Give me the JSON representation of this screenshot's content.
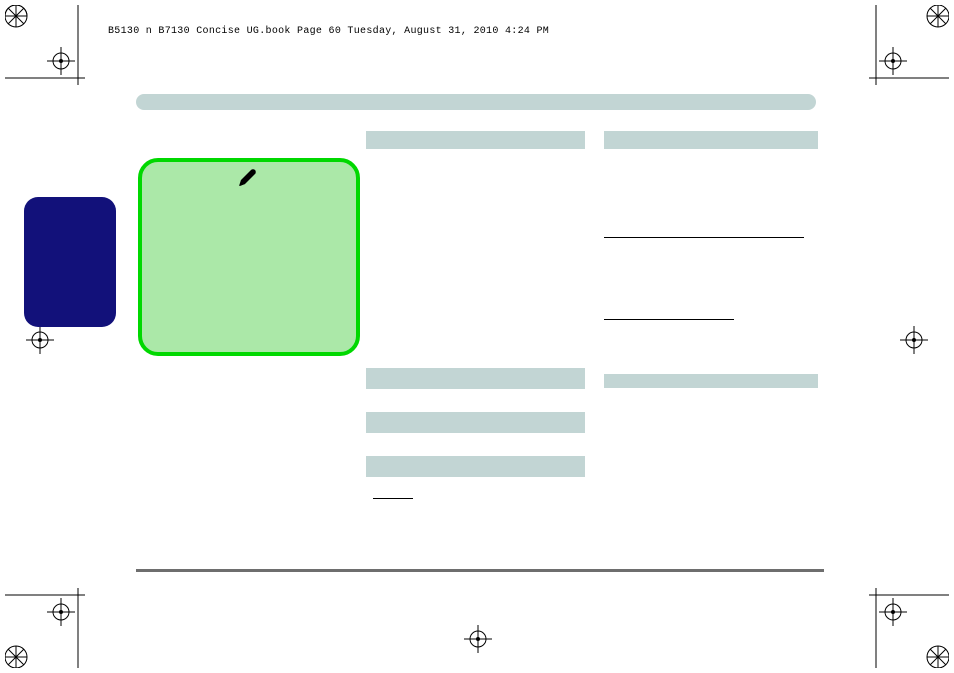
{
  "header": {
    "running_head": "B5130 n B7130 Concise UG.book  Page 60  Tuesday, August 31, 2010  4:24 PM"
  },
  "registration": {
    "corner_icon": "registration-corner",
    "side_icon": "registration-crosshair"
  },
  "icons": {
    "pen": "pen-icon"
  },
  "bars": {
    "page_title": "",
    "col_left_header": "",
    "col_right_header": "",
    "mid_left_1": "",
    "mid_left_2": "",
    "mid_left_3": "",
    "col_right_header_2": ""
  }
}
